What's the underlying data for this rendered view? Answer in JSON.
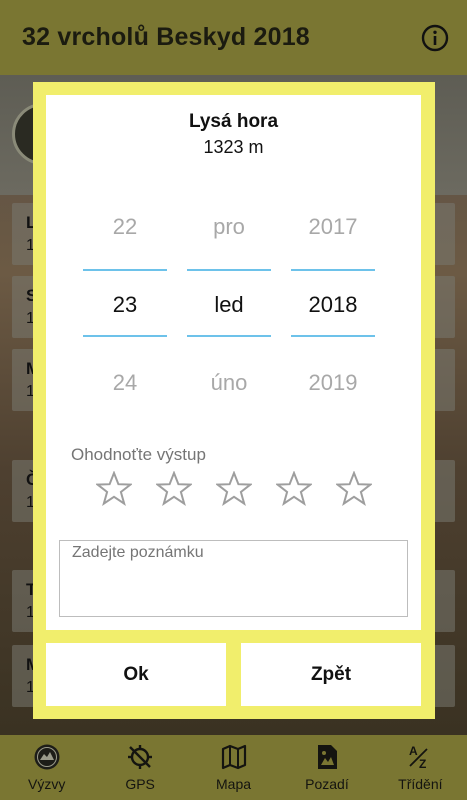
{
  "app": {
    "title": "32 vrcholů Beskyd 2018",
    "info_icon": "info-icon"
  },
  "background_list": [
    {
      "letter": "L",
      "sub": "1"
    },
    {
      "letter": "S",
      "sub": "1"
    },
    {
      "letter": "M",
      "sub": "1"
    },
    {
      "letter": "Č",
      "sub": "1"
    },
    {
      "letter": "T",
      "sub": "1"
    },
    {
      "letter": "M",
      "sub": "1"
    }
  ],
  "dialog": {
    "peak_name": "Lysá hora",
    "peak_height": "1323 m",
    "date_picker": {
      "day": {
        "prev": "22",
        "current": "23",
        "next": "24"
      },
      "month": {
        "prev": "pro",
        "current": "led",
        "next": "úno"
      },
      "year": {
        "prev": "2017",
        "current": "2018",
        "next": "2019"
      }
    },
    "rating_label": "Ohodnoťte výstup",
    "rating_value": 0,
    "rating_max": 5,
    "note_placeholder": "Zadejte poznámku",
    "note_value": "",
    "ok_label": "Ok",
    "back_label": "Zpět",
    "colors": {
      "frame": "#f1ee6c",
      "picker_line": "#6dc2ea"
    }
  },
  "bottom_nav": [
    {
      "label": "Výzvy",
      "icon": "challenges-badge-icon"
    },
    {
      "label": "GPS",
      "icon": "gps-off-icon"
    },
    {
      "label": "Mapa",
      "icon": "map-icon"
    },
    {
      "label": "Pozadí",
      "icon": "image-icon"
    },
    {
      "label": "Třídění",
      "icon": "sort-az-icon"
    }
  ],
  "colors": {
    "bar": "#7a7632"
  }
}
